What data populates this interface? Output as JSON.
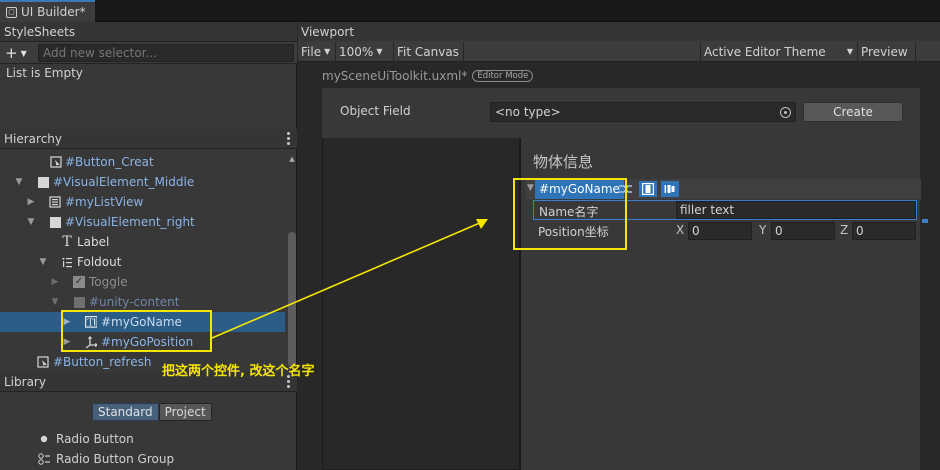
{
  "window": {
    "tab_title": "UI Builder*"
  },
  "stylesheets": {
    "header": "StyleSheets",
    "add_button": "+",
    "selector_placeholder": "Add new selector...",
    "empty_text": "List is Empty"
  },
  "hierarchy": {
    "header": "Hierarchy",
    "items": [
      {
        "label": "#Button_Creat"
      },
      {
        "label": "#VisualElement_Middle"
      },
      {
        "label": "#myListView"
      },
      {
        "label": "#VisualElement_right"
      },
      {
        "label": "Label"
      },
      {
        "label": "Foldout"
      },
      {
        "label": "Toggle"
      },
      {
        "label": "#unity-content"
      },
      {
        "label": "#myGoName"
      },
      {
        "label": "#myGoPosition"
      },
      {
        "label": "#Button_refresh"
      }
    ]
  },
  "library": {
    "header": "Library",
    "tabs": [
      "Standard",
      "Project"
    ],
    "items": [
      {
        "label": "Radio Button"
      },
      {
        "label": "Radio Button Group"
      }
    ]
  },
  "viewport": {
    "header": "Viewport",
    "toolbar": {
      "file": "File",
      "zoom": "100%",
      "fit": "Fit Canvas",
      "theme": "Active Editor Theme",
      "preview": "Preview"
    },
    "document_title": "mySceneUiToolkit.uxml*",
    "mode_badge": "Editor Mode",
    "object_field": {
      "label": "Object Field",
      "value": "<no type>",
      "button": "Create"
    },
    "foldout_title": "物体信息",
    "selected_element": "#myGoName",
    "name_field": {
      "label": "Name名字",
      "value": "filler text"
    },
    "position_field": {
      "label": "Position坐标",
      "x_label": "X",
      "x": "0",
      "y_label": "Y",
      "y": "0",
      "z_label": "Z",
      "z": "0"
    }
  },
  "annotation": {
    "text": "把这两个控件, 改这个名字",
    "color": "#f5e600"
  },
  "colors": {
    "selection": "#2c5d87",
    "accent": "#2f74b7",
    "element_name": "#8bb3e6"
  }
}
